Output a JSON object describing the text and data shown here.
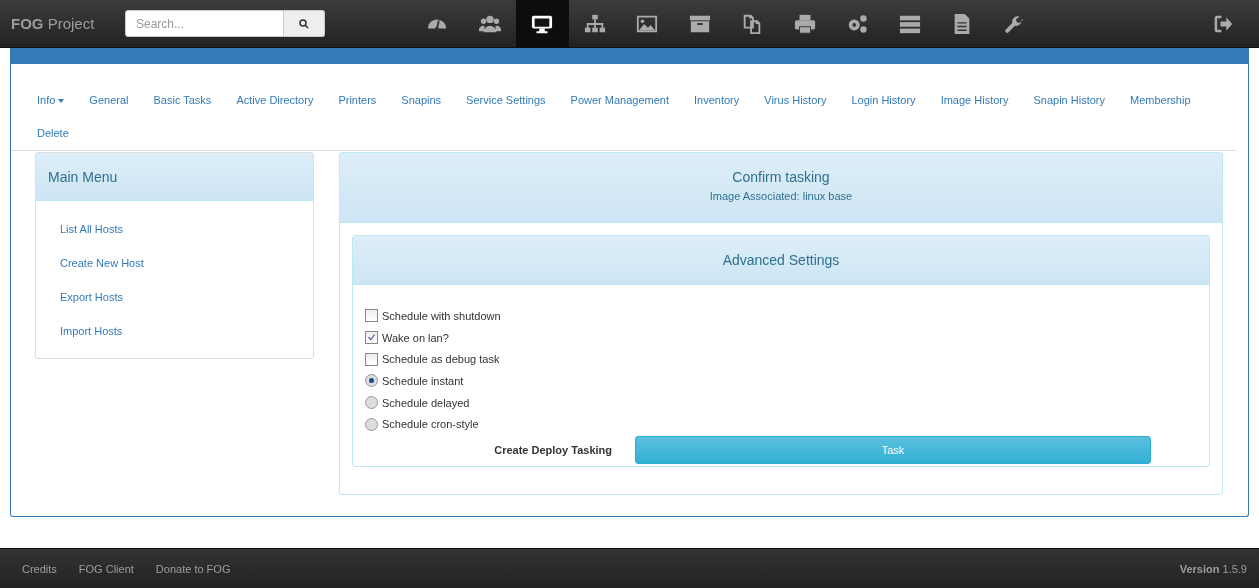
{
  "navbar": {
    "brand": "**FOG** Project",
    "search": {
      "placeholder": "Search..."
    },
    "nav_icons": [
      {
        "selected": false
      },
      {
        "selected": false
      },
      {
        "selected": true
      },
      {
        "selected": false
      },
      {
        "selected": false
      },
      {
        "selected": false
      },
      {
        "selected": false
      },
      {
        "selected": false
      },
      {
        "selected": false
      },
      {
        "selected": false
      },
      {
        "selected": false
      },
      {
        "selected": false
      }
    ]
  },
  "tabs": [
    {
      "label": "Info",
      "dropdown": true
    },
    {
      "label": "General",
      "dropdown": false
    },
    {
      "label": "Basic Tasks",
      "dropdown": false
    },
    {
      "label": "Active Directory",
      "dropdown": false
    },
    {
      "label": "Printers",
      "dropdown": false
    },
    {
      "label": "Snapins",
      "dropdown": false
    },
    {
      "label": "Service Settings",
      "dropdown": false
    },
    {
      "label": "Power Management",
      "dropdown": false
    },
    {
      "label": "Inventory",
      "dropdown": false
    },
    {
      "label": "Virus History",
      "dropdown": false
    },
    {
      "label": "Login History",
      "dropdown": false
    },
    {
      "label": "Image History",
      "dropdown": false
    },
    {
      "label": "Snapin History",
      "dropdown": false
    },
    {
      "label": "Membership",
      "dropdown": false
    },
    {
      "label": "Delete",
      "dropdown": false
    }
  ],
  "main_menu": {
    "title": "Main Menu",
    "items": [
      "List All Hosts",
      "Create New Host",
      "Export Hosts",
      "Import Hosts"
    ]
  },
  "confirm": {
    "title": "Confirm tasking",
    "subtitle": "Image Associated: linux base",
    "advanced": {
      "title": "Advanced Settings",
      "options": [
        {
          "kind": "checkbox",
          "label": "Schedule with shutdown",
          "checked": false
        },
        {
          "kind": "checkbox",
          "label": "Wake on lan?",
          "checked": true
        },
        {
          "kind": "checkbox",
          "label": "Schedule as debug task",
          "checked": false
        },
        {
          "kind": "radio",
          "label": "Schedule instant",
          "checked": true
        },
        {
          "kind": "radio",
          "label": "Schedule delayed",
          "checked": false
        },
        {
          "kind": "radio",
          "label": "Schedule cron-style",
          "checked": false
        }
      ],
      "submit_label": "Create Deploy Tasking",
      "submit_button": "Task"
    }
  },
  "footer": {
    "links": [
      "Credits",
      "FOG Client",
      "Donate to FOG"
    ],
    "version": "**Version** 1.5.9"
  }
}
